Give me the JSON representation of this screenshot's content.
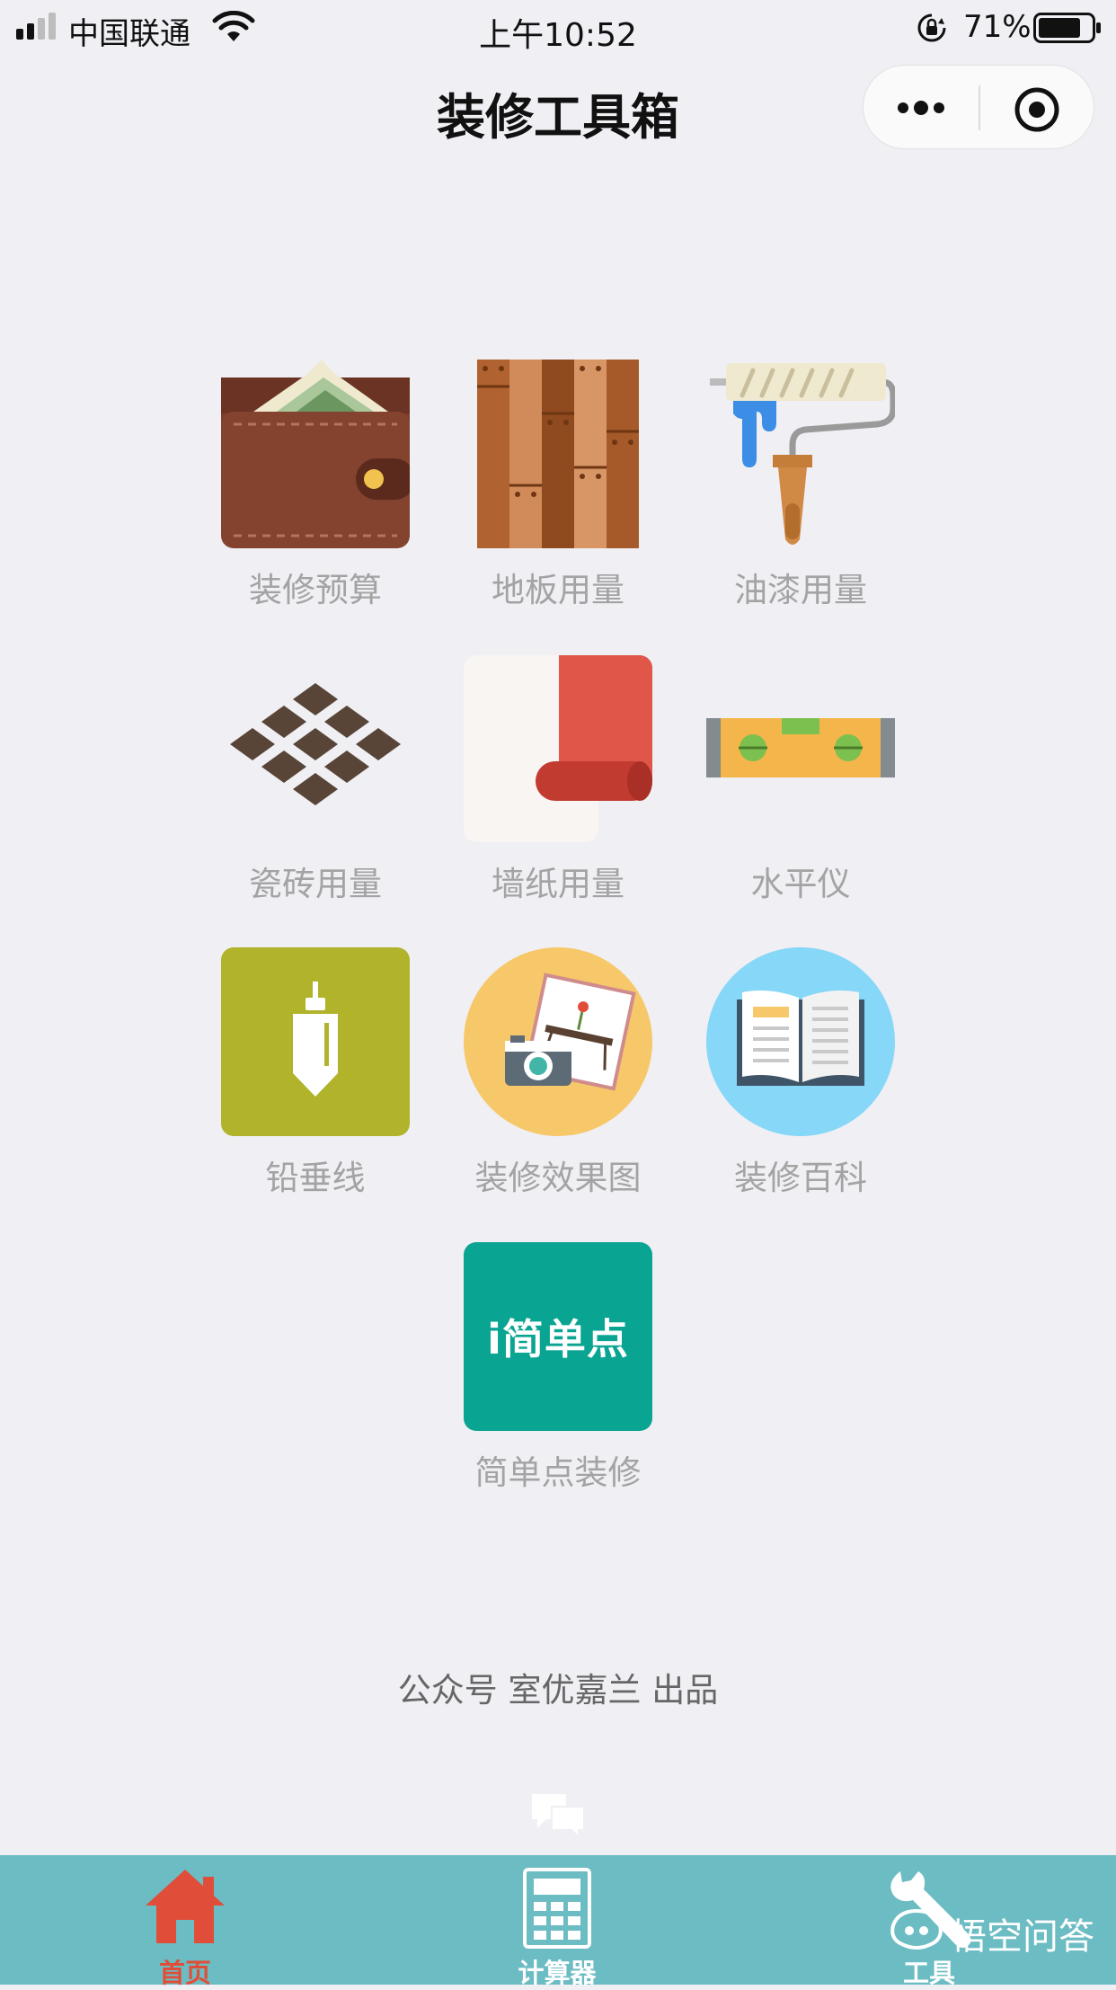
{
  "status_bar": {
    "carrier": "中国联通",
    "time": "上午10:52",
    "battery": "71%"
  },
  "nav": {
    "title": "装修工具箱"
  },
  "tools": [
    {
      "label": "装修预算",
      "icon": "wallet-icon"
    },
    {
      "label": "地板用量",
      "icon": "wood-floor-icon"
    },
    {
      "label": "油漆用量",
      "icon": "paint-roller-icon"
    },
    {
      "label": "瓷砖用量",
      "icon": "tiles-icon"
    },
    {
      "label": "墙纸用量",
      "icon": "wallpaper-roll-icon"
    },
    {
      "label": "水平仪",
      "icon": "spirit-level-icon"
    },
    {
      "label": "铅垂线",
      "icon": "plumb-bob-icon"
    },
    {
      "label": "装修效果图",
      "icon": "photo-camera-icon"
    },
    {
      "label": "装修百科",
      "icon": "open-book-icon"
    },
    {
      "label": "简单点装修",
      "icon": "jiandandian-logo-icon",
      "logo_text": "i简单点"
    }
  ],
  "footer": {
    "credit": "公众号 室优嘉兰 出品"
  },
  "tab_bar": {
    "background": "#6cbcc3",
    "tabs": [
      {
        "label": "首页",
        "icon": "home-icon",
        "color": "#e04e3a"
      },
      {
        "label": "计算器",
        "icon": "calculator-icon",
        "color": "#ffffff"
      },
      {
        "label": "工具",
        "icon": "wrench-icon",
        "color": "#ffffff"
      }
    ]
  },
  "watermark": "悟空问答"
}
